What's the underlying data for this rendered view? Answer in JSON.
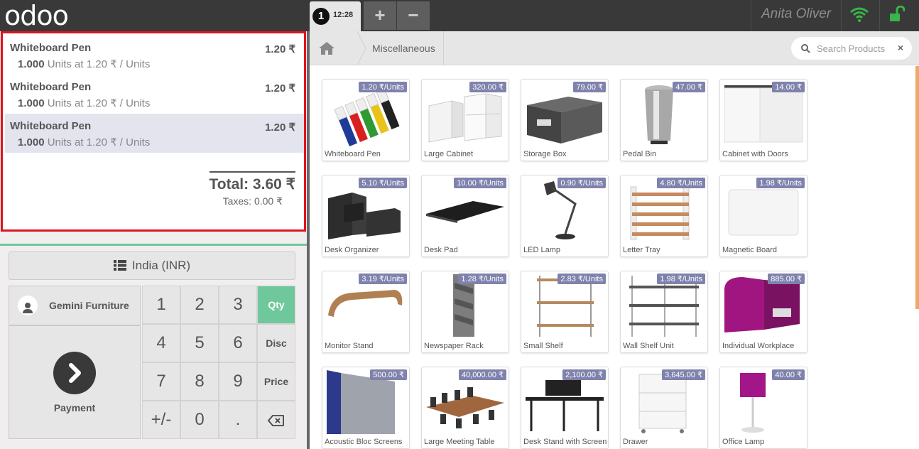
{
  "header": {
    "logo": "odoo",
    "order_number": "1",
    "order_time": "12:28",
    "add_label": "+",
    "remove_label": "−",
    "user_name": "Anita Oliver"
  },
  "order": {
    "lines": [
      {
        "name": "Whiteboard Pen",
        "price": "1.20 ₹",
        "qty": "1.000",
        "unit_info": "Units at 1.20 ₹ / Units",
        "selected": false
      },
      {
        "name": "Whiteboard Pen",
        "price": "1.20 ₹",
        "qty": "1.000",
        "unit_info": "Units at 1.20 ₹ / Units",
        "selected": false
      },
      {
        "name": "Whiteboard Pen",
        "price": "1.20 ₹",
        "qty": "1.000",
        "unit_info": "Units at 1.20 ₹ / Units",
        "selected": true
      }
    ],
    "total": "Total: 3.60 ₹",
    "taxes": "Taxes: 0.00 ₹"
  },
  "controls": {
    "currency": "India (INR)",
    "customer": "Gemini Furniture",
    "payment": "Payment",
    "keys": [
      "1",
      "2",
      "3",
      "Qty",
      "4",
      "5",
      "6",
      "Disc",
      "7",
      "8",
      "9",
      "Price",
      "+/-",
      "0",
      "."
    ],
    "active_mode": "Qty"
  },
  "breadcrumb": {
    "category": "Miscellaneous"
  },
  "search": {
    "placeholder": "Search Products",
    "clear": "×"
  },
  "colors": {
    "accent": "#6ec89b",
    "price_tag": "#7f82ac",
    "highlight": "#e0141e"
  },
  "products": [
    {
      "name": "Whiteboard Pen",
      "price": "1.20 ₹/Units"
    },
    {
      "name": "Large Cabinet",
      "price": "320.00 ₹"
    },
    {
      "name": "Storage Box",
      "price": "79.00 ₹"
    },
    {
      "name": "Pedal Bin",
      "price": "47.00 ₹"
    },
    {
      "name": "Cabinet with Doors",
      "price": "14.00 ₹"
    },
    {
      "name": "Desk Organizer",
      "price": "5.10 ₹/Units"
    },
    {
      "name": "Desk Pad",
      "price": "10.00 ₹/Units"
    },
    {
      "name": "LED Lamp",
      "price": "0.90 ₹/Units"
    },
    {
      "name": "Letter Tray",
      "price": "4.80 ₹/Units"
    },
    {
      "name": "Magnetic Board",
      "price": "1.98 ₹/Units"
    },
    {
      "name": "Monitor Stand",
      "price": "3.19 ₹/Units"
    },
    {
      "name": "Newspaper Rack",
      "price": "1.28 ₹/Units"
    },
    {
      "name": "Small Shelf",
      "price": "2.83 ₹/Units"
    },
    {
      "name": "Wall Shelf Unit",
      "price": "1.98 ₹/Units"
    },
    {
      "name": "Individual Workplace",
      "price": "885.00 ₹"
    },
    {
      "name": "Acoustic Bloc Screens",
      "price": "500.00 ₹"
    },
    {
      "name": "Large Meeting Table",
      "price": "40,000.00 ₹"
    },
    {
      "name": "Desk Stand with Screen",
      "price": "2,100.00 ₹"
    },
    {
      "name": "Drawer",
      "price": "3,645.00 ₹"
    },
    {
      "name": "Office Lamp",
      "price": "40.00 ₹"
    }
  ]
}
